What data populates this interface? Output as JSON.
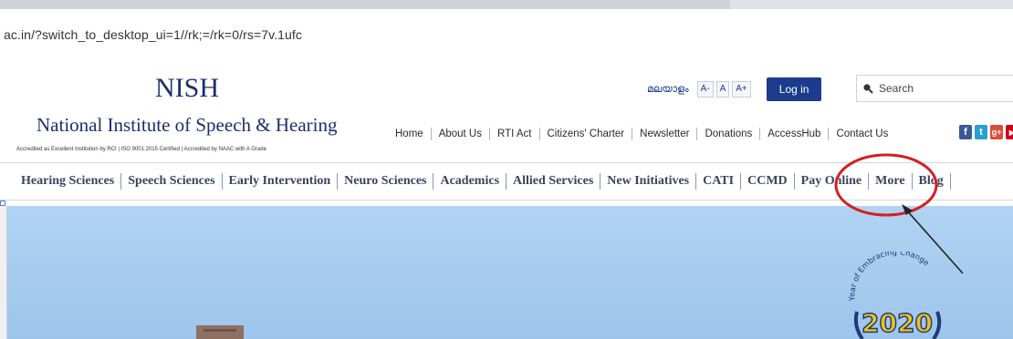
{
  "browser": {
    "url": "ac.in/?switch_to_desktop_ui=1//rk;=/rk=0/rs=7v.1ufc"
  },
  "header": {
    "brand_short": "NISH",
    "brand_full": "National Institute of Speech & Hearing",
    "accreditation": "Accredited as Excellent Institution by RCI | ISO 9001:2015 Certified | Accredited by NAAC with A Grade",
    "language_link": "മലയാളം",
    "font_sizes": [
      "A-",
      "A",
      "A+"
    ],
    "login_label": "Log in",
    "search_placeholder": "Search",
    "top_nav": [
      "Home",
      "About Us",
      "RTI Act",
      "Citizens' Charter",
      "Newsletter",
      "Donations",
      "AccessHub",
      "Contact Us"
    ],
    "social": [
      {
        "icon": "facebook-icon",
        "glyph": "f",
        "color": "#3b5998"
      },
      {
        "icon": "twitter-icon",
        "glyph": "t",
        "color": "#2a9fd6"
      },
      {
        "icon": "googleplus-icon",
        "glyph": "g+",
        "color": "#dd4b39"
      },
      {
        "icon": "youtube-icon",
        "glyph": "▶",
        "color": "#d0021b"
      }
    ]
  },
  "main_menu": {
    "items": [
      "Hearing Sciences",
      "Speech Sciences",
      "Early Intervention",
      "Neuro Sciences",
      "Academics",
      "Allied Services",
      "New Initiatives",
      "CATI",
      "CCMD",
      "Pay Online",
      "More",
      "Blog"
    ]
  },
  "hero": {
    "badge_caption": "Year of Embracing Change",
    "badge_year": "2020"
  },
  "annotation": {
    "highlight_color": "#d42020",
    "arrow_color": "#222222",
    "target": "Pay Online"
  }
}
